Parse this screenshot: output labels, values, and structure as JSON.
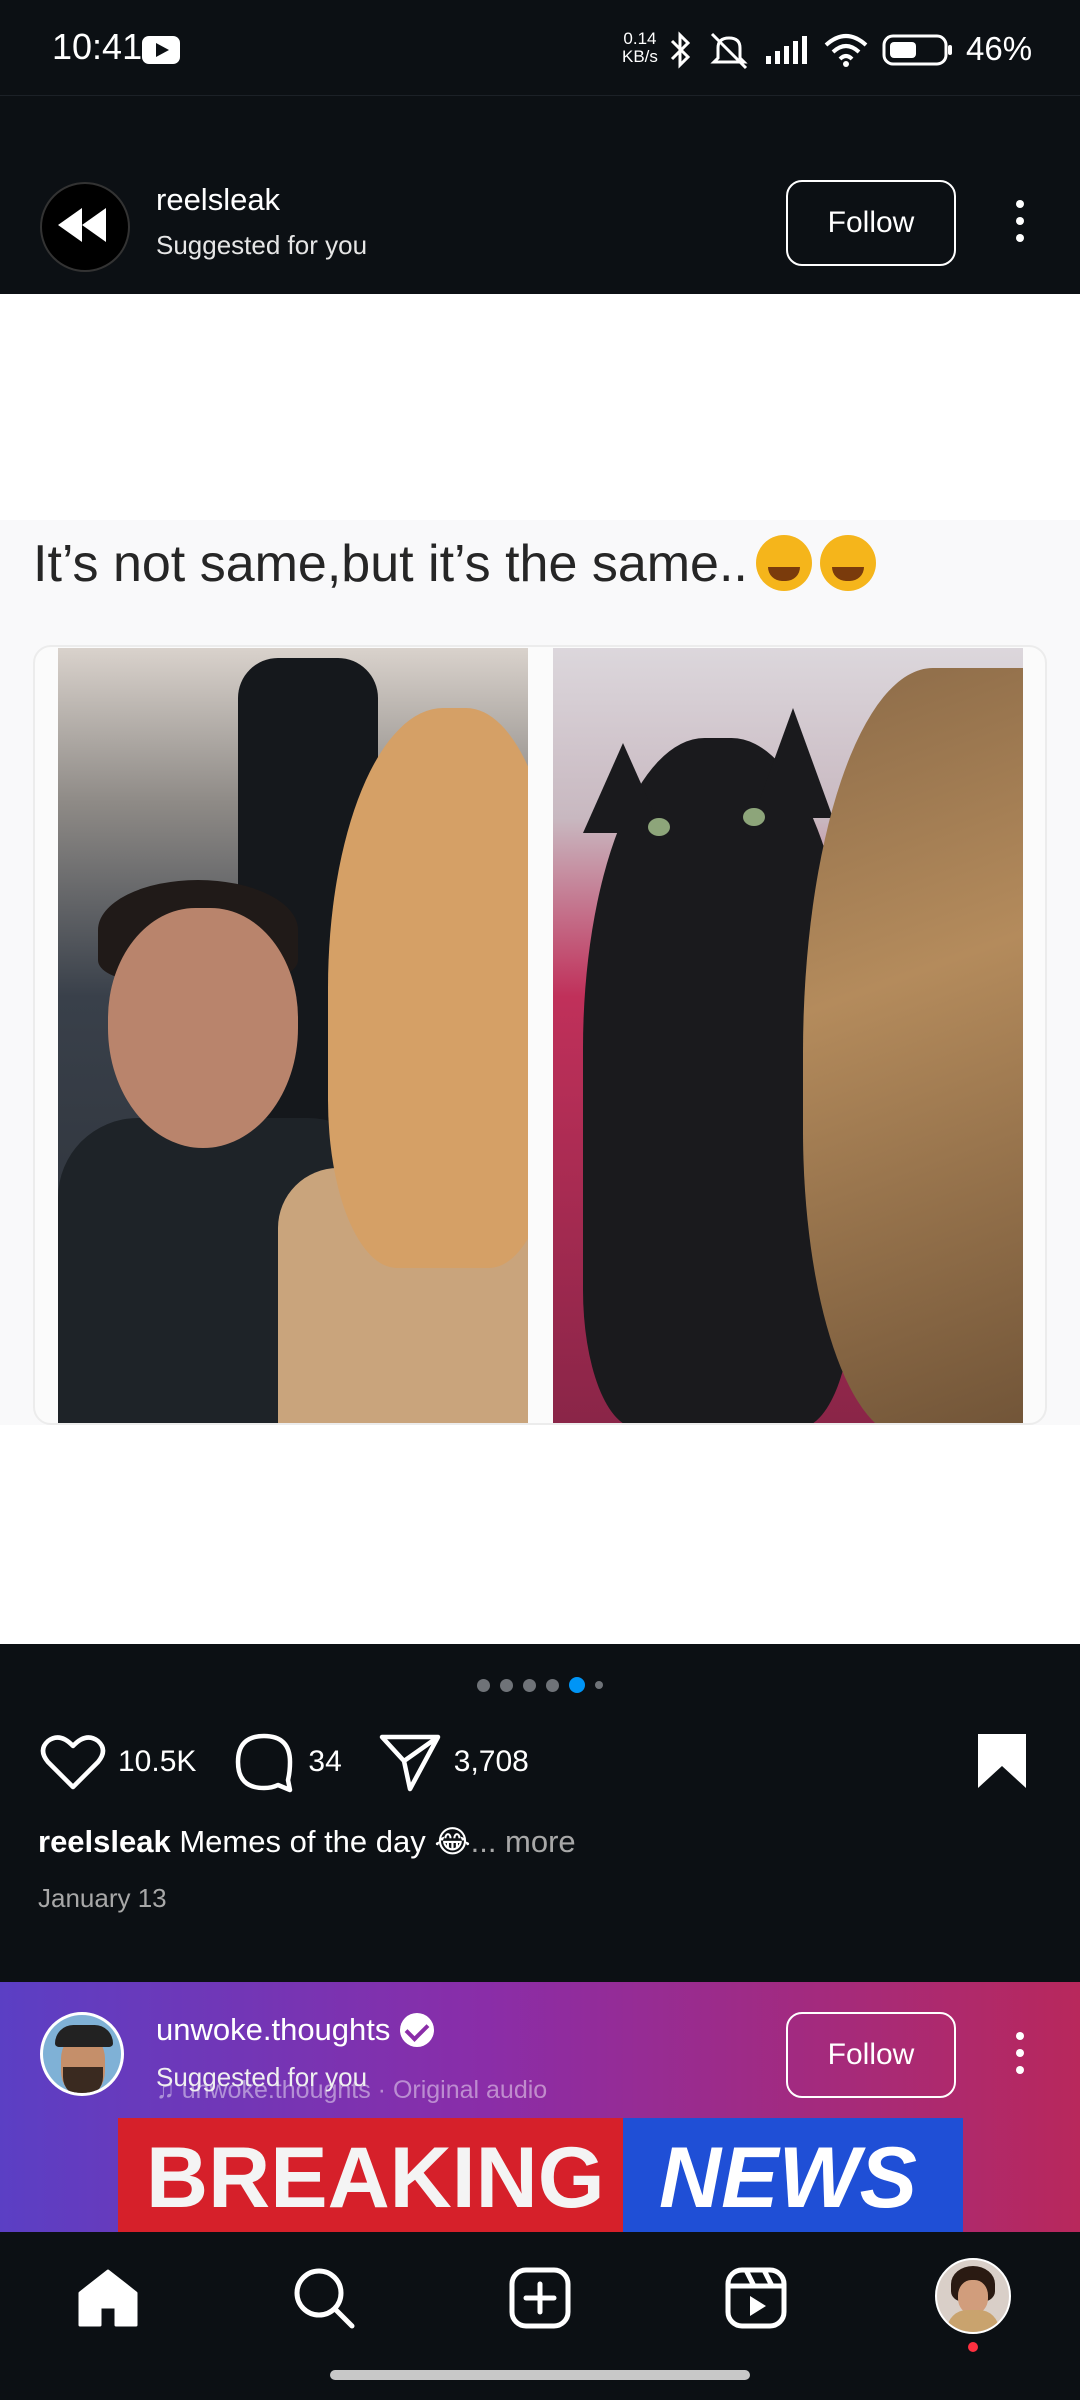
{
  "status_bar": {
    "time": "10:41",
    "net_speed_value": "0.14",
    "net_speed_unit": "KB/s",
    "battery": "46%"
  },
  "post": {
    "username": "reelsleak",
    "subtitle": "Suggested for you",
    "follow_label": "Follow",
    "meme_text": "It’s not same,but it’s the same..",
    "carousel": {
      "total": 6,
      "active": 5
    },
    "likes": "10.5K",
    "comments": "34",
    "shares": "3,708",
    "caption_user": "reelsleak",
    "caption_text": "Memes of the day 😂",
    "more_label": "... more",
    "date": "January 13"
  },
  "next_post": {
    "username": "unwoke.thoughts",
    "subtitle": "Suggested for you",
    "audio": "♫ unwoke.thoughts · Original audio",
    "follow_label": "Follow",
    "banner_left": "BREAKING",
    "banner_right": "NEWS"
  },
  "bottom_nav": {
    "items": [
      "home-icon",
      "search-icon",
      "create-icon",
      "reels-icon",
      "profile-avatar"
    ]
  },
  "colors": {
    "background": "#0c1014",
    "accent": "#0095f6",
    "notification": "#ff3040"
  }
}
